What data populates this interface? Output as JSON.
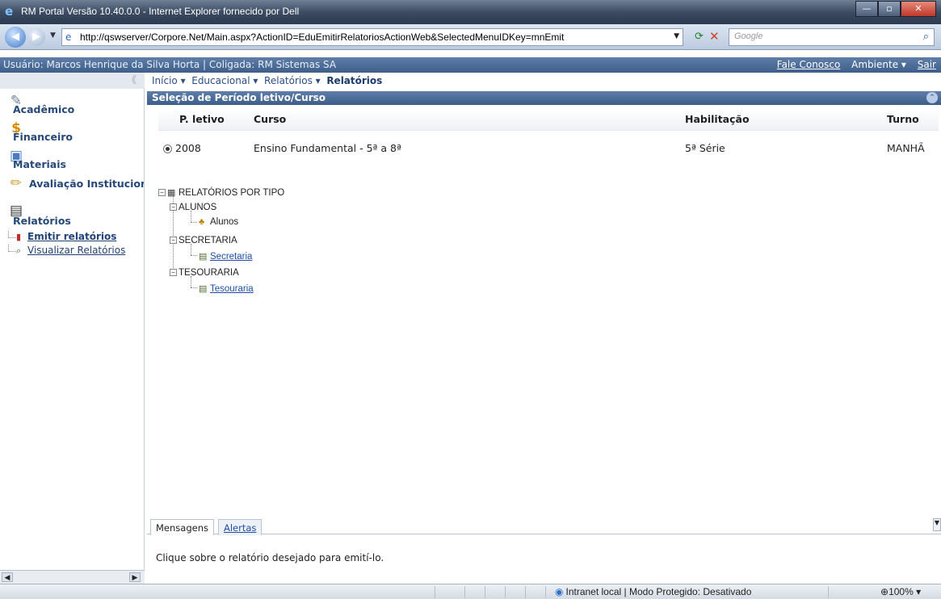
{
  "window": {
    "title": "RM Portal Versão 10.40.0.0 - Internet Explorer fornecido por Dell",
    "controls": [
      "minimize",
      "maximize",
      "close"
    ]
  },
  "browser": {
    "url": "http://qswserver/Corpore.Net/Main.aspx?ActionID=EduEmitirRelatoriosActionWeb&SelectedMenuIDKey=mnEmit",
    "search_placeholder": "Google"
  },
  "userbar": {
    "user_text": "Usuário: Marcos Henrique da Silva Horta  |  Coligada: RM Sistemas SA",
    "fale_conosco": "Fale Conosco",
    "ambiente": "Ambiente ▾",
    "sair": "Sair"
  },
  "sidebar": {
    "collapse_label": "《",
    "modules": [
      {
        "label": "Acadêmico",
        "icon": "tools-icon"
      },
      {
        "label": "Financeiro",
        "icon": "money-icon"
      },
      {
        "label": "Materiais",
        "icon": "box-icon"
      },
      {
        "label": "Avaliação Institucional",
        "icon": "pencil-icon"
      },
      {
        "label": "Relatórios",
        "icon": "report-icon"
      }
    ],
    "subitems": [
      {
        "label": "Emitir relatórios",
        "active": true
      },
      {
        "label": "Visualizar Relatórios",
        "active": false
      }
    ]
  },
  "breadcrumb": {
    "inicio": "Início ▾",
    "educacional": "Educacional ▾",
    "relatorios": "Relatórios ▾",
    "current": "Relatórios"
  },
  "panel": {
    "title": "Seleção de Período letivo/Curso",
    "columns": [
      "P. letivo",
      "Curso",
      "Habilitação",
      "Turno"
    ],
    "rows": [
      {
        "periodo": "2008",
        "curso": "Ensino Fundamental - 5ª a 8ª",
        "habilitacao": "5ª Série",
        "turno": "MANHÃ"
      }
    ]
  },
  "tree": {
    "root": "RELATÓRIOS POR TIPO",
    "groups": [
      {
        "label": "ALUNOS",
        "child": "Alunos"
      },
      {
        "label": "SECRETARIA",
        "child": "Secretaria"
      },
      {
        "label": "TESOURARIA",
        "child": "Tesouraria"
      }
    ]
  },
  "messages": {
    "tab_mensagens": "Mensagens",
    "tab_alertas": "Alertas",
    "text": "Clique sobre o relatório desejado para emití-lo."
  },
  "statusbar": {
    "zone": "Intranet local | Modo Protegido: Desativado",
    "zoom": "100%"
  }
}
